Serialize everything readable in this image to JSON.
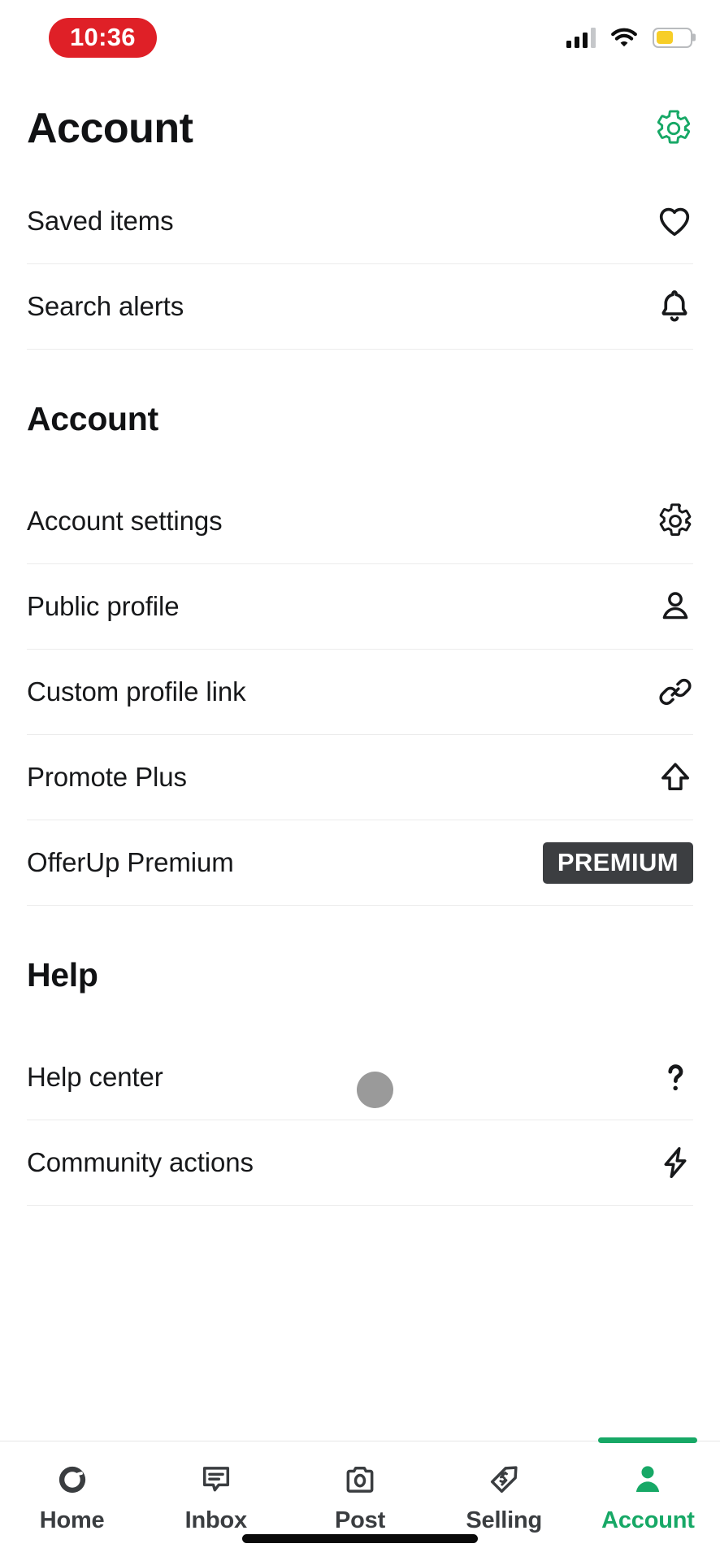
{
  "status_bar": {
    "time": "10:36",
    "time_pill_color": "#DF2027",
    "signal_icon": "cellular-signal-icon",
    "wifi_icon": "wifi-icon",
    "battery_icon": "battery-icon",
    "battery_level_percent": 52,
    "battery_color": "#F7CE28"
  },
  "header": {
    "title": "Account",
    "settings_icon": "gear-icon",
    "settings_icon_color": "#17A866"
  },
  "quick_links": [
    {
      "label": "Saved items",
      "icon": "heart-icon"
    },
    {
      "label": "Search alerts",
      "icon": "bell-icon"
    }
  ],
  "sections": [
    {
      "title": "Account",
      "items": [
        {
          "label": "Account settings",
          "icon": "gear-icon"
        },
        {
          "label": "Public profile",
          "icon": "person-icon"
        },
        {
          "label": "Custom profile link",
          "icon": "link-icon"
        },
        {
          "label": "Promote Plus",
          "icon": "arrow-up-icon"
        },
        {
          "label": "OfferUp Premium",
          "badge": "PREMIUM",
          "badge_color": "#3C3E41"
        }
      ]
    },
    {
      "title": "Help",
      "items": [
        {
          "label": "Help center",
          "icon": "question-mark-icon"
        },
        {
          "label": "Community actions",
          "icon": "lightning-bolt-icon"
        }
      ]
    }
  ],
  "tab_bar": {
    "active_color": "#17A866",
    "inactive_color": "#3A3D40",
    "tabs": [
      {
        "label": "Home",
        "icon": "offerup-logo-icon",
        "active": false
      },
      {
        "label": "Inbox",
        "icon": "chat-bubble-icon",
        "active": false
      },
      {
        "label": "Post",
        "icon": "camera-icon",
        "active": false
      },
      {
        "label": "Selling",
        "icon": "price-tag-icon",
        "active": false
      },
      {
        "label": "Account",
        "icon": "person-filled-icon",
        "active": true
      }
    ]
  }
}
